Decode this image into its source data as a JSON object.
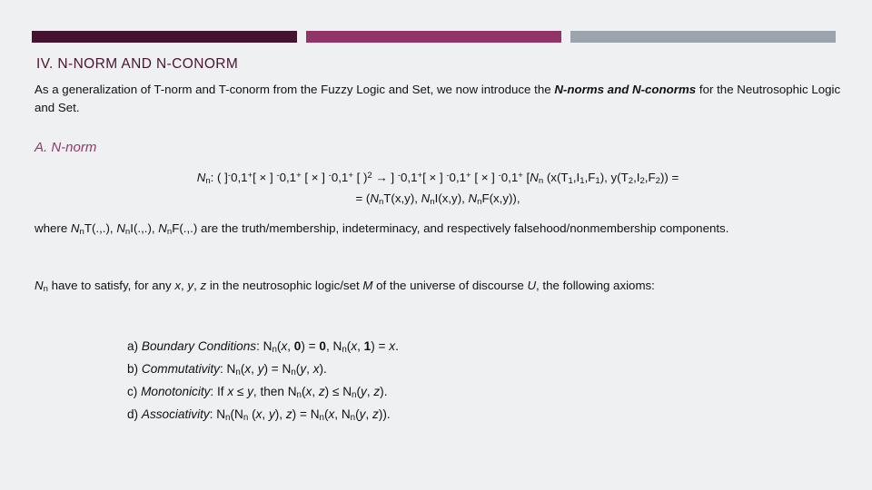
{
  "slide": {
    "background_color": "#eff0f2",
    "bars": [
      {
        "name": "dark-bar",
        "color": "#441330"
      },
      {
        "name": "magenta-bar",
        "color": "#913569"
      },
      {
        "name": "gray-bar",
        "color": "#9ba3ad"
      }
    ],
    "title": "IV. N-NORM AND N-CONORM",
    "title_color": "#4a1433",
    "intro": {
      "before_italic": "As a generalization of T-norm and T-conorm from the Fuzzy Logic and Set, we now introduce the ",
      "italic": "N-norms and N-conorms",
      "after_italic": " for the Neutrosophic Logic and Set."
    },
    "subhead": "A. N-norm",
    "subhead_color": "#8e3a6b",
    "formula": {
      "line1": {
        "name_italic": "N",
        "name_sub": "n",
        "body_a": ": ( ]",
        "neg1": "-",
        "seg1": "0,1",
        "sup1": "+",
        "seg2": "[ × ] ",
        "neg2": "-",
        "seg3": "0,1",
        "sup2": "+",
        "seg4": " [ × ] ",
        "neg3": "-",
        "seg5": "0,1",
        "sup3": "+",
        "seg6": " [ )",
        "power": "2",
        "arrow": " → ] ",
        "neg4": "-",
        "seg7": "0,1",
        "sup4": "+",
        "seg8": "[ × ] ",
        "neg5": "-",
        "seg9": "0,1",
        "sup5": "+",
        "seg10": " [ × ] ",
        "neg6": "-",
        "seg11": "0,1",
        "sup6": "+",
        "seg12": " [",
        "fn_italic": "N",
        "fn_sub": "n",
        "tail": " (x(T",
        "t1": "1",
        "tail2": ",I",
        "i1": "1",
        "tail3": ",F",
        "f1": "1",
        "tail4": "), y(T",
        "t2": "2",
        "tail5": ",I",
        "i2": "2",
        "tail6": ",F",
        "f2": "2",
        "tail7": ")) ="
      },
      "line2": {
        "open": "= (",
        "n1_italic": "N",
        "n1_sub": "n",
        "t_part": "T(x,y), ",
        "n2_italic": "N",
        "n2_sub": "n",
        "i_part": "I(x,y), ",
        "n3_italic": "N",
        "n3_sub": "n",
        "f_part": "F(x,y)),"
      }
    },
    "where_paragraph": {
      "w1": "where ",
      "n1": "N",
      "n1s": "n",
      "p1": "T(.,.), ",
      "n2": "N",
      "n2s": "n",
      "p2": "I(.,.), ",
      "n3": "N",
      "n3s": "n",
      "p3": "F(.,.) are the truth/membership, indeterminacy, and respectively falsehood/nonmembership components."
    },
    "axiom_intro": {
      "n_italic": "N",
      "n_sub": "n",
      "seg1": " have to satisfy, for any ",
      "x": "x",
      "seg2": ", ",
      "y": "y",
      "seg3": ", ",
      "z": "z",
      "seg4": " in the neutrosophic logic/set ",
      "m": "M",
      "seg5": " of the universe of discourse ",
      "u": "U",
      "seg6": ", the following axioms:"
    },
    "axioms": [
      {
        "label": "a) ",
        "name": "Boundary Conditions",
        "text_parts": {
          "p1": ": N",
          "s1": "n",
          "p2": "(",
          "i1": "x",
          "p3": ", ",
          "b1": "0",
          "p4": ") = ",
          "b2": "0",
          "p5": ", N",
          "s2": "n",
          "p6": "(",
          "i2": "x",
          "p7": ", ",
          "b3": "1",
          "p8": ") = ",
          "i3": "x",
          "p9": "."
        }
      },
      {
        "label": "b) ",
        "name": "Commutativity",
        "text_parts": {
          "p1": ": N",
          "s1": "n",
          "p2": "(",
          "i1": "x",
          "p3": ", ",
          "i2": "y",
          "p4": ") = N",
          "s2": "n",
          "p5": "(",
          "i3": "y",
          "p6": ", ",
          "i4": "x",
          "p7": ")."
        }
      },
      {
        "label": "c) ",
        "name": "Monotonicity",
        "text_parts": {
          "p1": ": If ",
          "i1": "x",
          "p2": " ≤ ",
          "i2": "y",
          "p3": ", then N",
          "s1": "n",
          "p4": "(",
          "i3": "x",
          "p5": ", ",
          "i4": "z",
          "p6": ") ≤ N",
          "s2": "n",
          "p7": "(",
          "i5": "y",
          "p8": ", ",
          "i6": "z",
          "p9": ")."
        }
      },
      {
        "label": "d) ",
        "name": "Associativity",
        "text_parts": {
          "p1": ": N",
          "s1": "n",
          "p2": "(N",
          "s2": "n",
          "p3": " (",
          "i1": "x",
          "p4": ", ",
          "i2": "y",
          "p5": "), ",
          "i3": "z",
          "p6": ") = N",
          "s3": "n",
          "p7": "(",
          "i4": "x",
          "p8": ", N",
          "s4": "n",
          "p9": "(",
          "i5": "y",
          "p10": ", ",
          "i6": "z",
          "p11": "))."
        }
      }
    ]
  }
}
